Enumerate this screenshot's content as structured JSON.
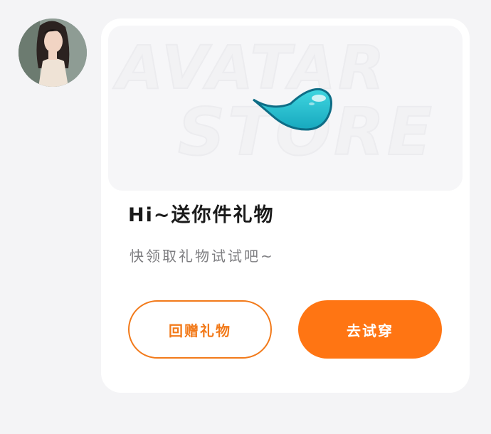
{
  "avatar": {
    "alt": "user avatar"
  },
  "card": {
    "banner": {
      "line1": "AVATAR",
      "line2": "STORE",
      "icon": "droplet-icon"
    },
    "title": "Hi~送你件礼物",
    "subtitle": "快领取礼物试试吧~",
    "buttons": {
      "return_gift": "回赠礼物",
      "try_on": "去试穿"
    }
  },
  "colors": {
    "accent": "#ff7513",
    "accent_outline": "#f27a1a",
    "droplet": "#2cc6d4"
  }
}
